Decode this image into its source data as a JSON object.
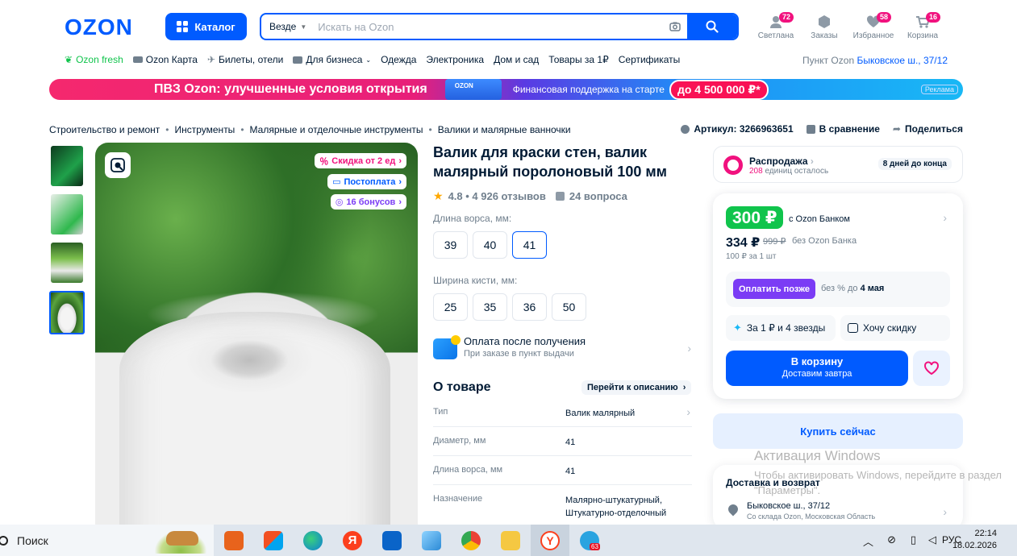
{
  "header": {
    "logo": "OZON",
    "catalog_label": "Каталог",
    "search_scope": "Везде",
    "search_placeholder": "Искать на Ozon",
    "items": [
      {
        "label": "Светлана",
        "badge": "72",
        "icon": "user-icon"
      },
      {
        "label": "Заказы",
        "badge": "",
        "icon": "box-icon"
      },
      {
        "label": "Избранное",
        "badge": "58",
        "icon": "heart-icon"
      },
      {
        "label": "Корзина",
        "badge": "16",
        "icon": "cart-icon"
      }
    ]
  },
  "nav": {
    "items": [
      "Ozon fresh",
      "Ozon Карта",
      "Билеты, отели",
      "Для бизнеса",
      "Одежда",
      "Электроника",
      "Дом и сад",
      "Товары за 1₽",
      "Сертификаты"
    ],
    "pickup_label": "Пункт Ozon",
    "pickup_value": "Быковское ш., 37/12"
  },
  "banner": {
    "title": "ПВЗ Ozon: улучшенные условия открытия",
    "subtitle": "Финансовая поддержка на старте",
    "amount": "до 4 500 000 ₽*",
    "ad": "Реклама"
  },
  "breadcrumbs": [
    "Строительство и ремонт",
    "Инструменты",
    "Малярные и отделочные инструменты",
    "Валики и малярные ванночки"
  ],
  "meta": {
    "article": "Артикул: 3266963651",
    "compare": "В сравнение",
    "share": "Поделиться"
  },
  "image_tags": {
    "discount": "Скидка от 2 ед",
    "postpay": "Постоплата",
    "bonus": "16 бонусов"
  },
  "product": {
    "title": "Валик для краски стен, валик малярный поролоновый 100 мм",
    "rating": "4.8 • 4 926 отзывов",
    "questions": "24 вопроса",
    "pile_label": "Длина ворса, мм:",
    "pile_options": [
      "39",
      "40",
      "41"
    ],
    "pile_selected": "41",
    "width_label": "Ширина кисти, мм:",
    "width_options": [
      "25",
      "35",
      "36",
      "50"
    ],
    "pay_after_title": "Оплата после получения",
    "pay_after_sub": "При заказе в пункт выдачи",
    "about_title": "О товаре",
    "about_link": "Перейти к описанию",
    "specs": [
      {
        "k": "Тип",
        "v": "Валик малярный"
      },
      {
        "k": "Диаметр, мм",
        "v": "41"
      },
      {
        "k": "Длина ворса, мм",
        "v": "41"
      },
      {
        "k": "Назначение",
        "v": "Малярно-штукатурный, Штукатурно-отделочный"
      }
    ]
  },
  "sale": {
    "title": "Распродажа",
    "count": "208",
    "count_suffix": "единиц осталось",
    "days": "8 дней до конца"
  },
  "price": {
    "main": "300 ₽",
    "main_label": "с Ozon Банком",
    "secondary": "334 ₽",
    "old": "999 ₽",
    "secondary_label": "без Ozon Банка",
    "unit": "100 ₽ за 1 шт",
    "pay_later_btn": "Оплатить позже",
    "pay_later_txt_a": "без % до ",
    "pay_later_txt_b": "4 мая",
    "for_one": "За 1 ₽ и 4 звезды",
    "want_discount": "Хочу скидку",
    "cart_a": "В корзину",
    "cart_b": "Доставим завтра"
  },
  "buy_now": "Купить сейчас",
  "delivery": {
    "title": "Доставка и возврат",
    "address": "Быковское ш., 37/12",
    "sub": "Со склада Ozon, Московская Область"
  },
  "watermark": {
    "line1": "Активация Windows",
    "line2": "Чтобы активировать Windows, перейдите в раздел \"Параметры\"."
  },
  "taskbar": {
    "search": "Поиск",
    "lang": "РУС",
    "time": "22:14",
    "date": "18.02.2026",
    "telegram_badge": "63"
  }
}
